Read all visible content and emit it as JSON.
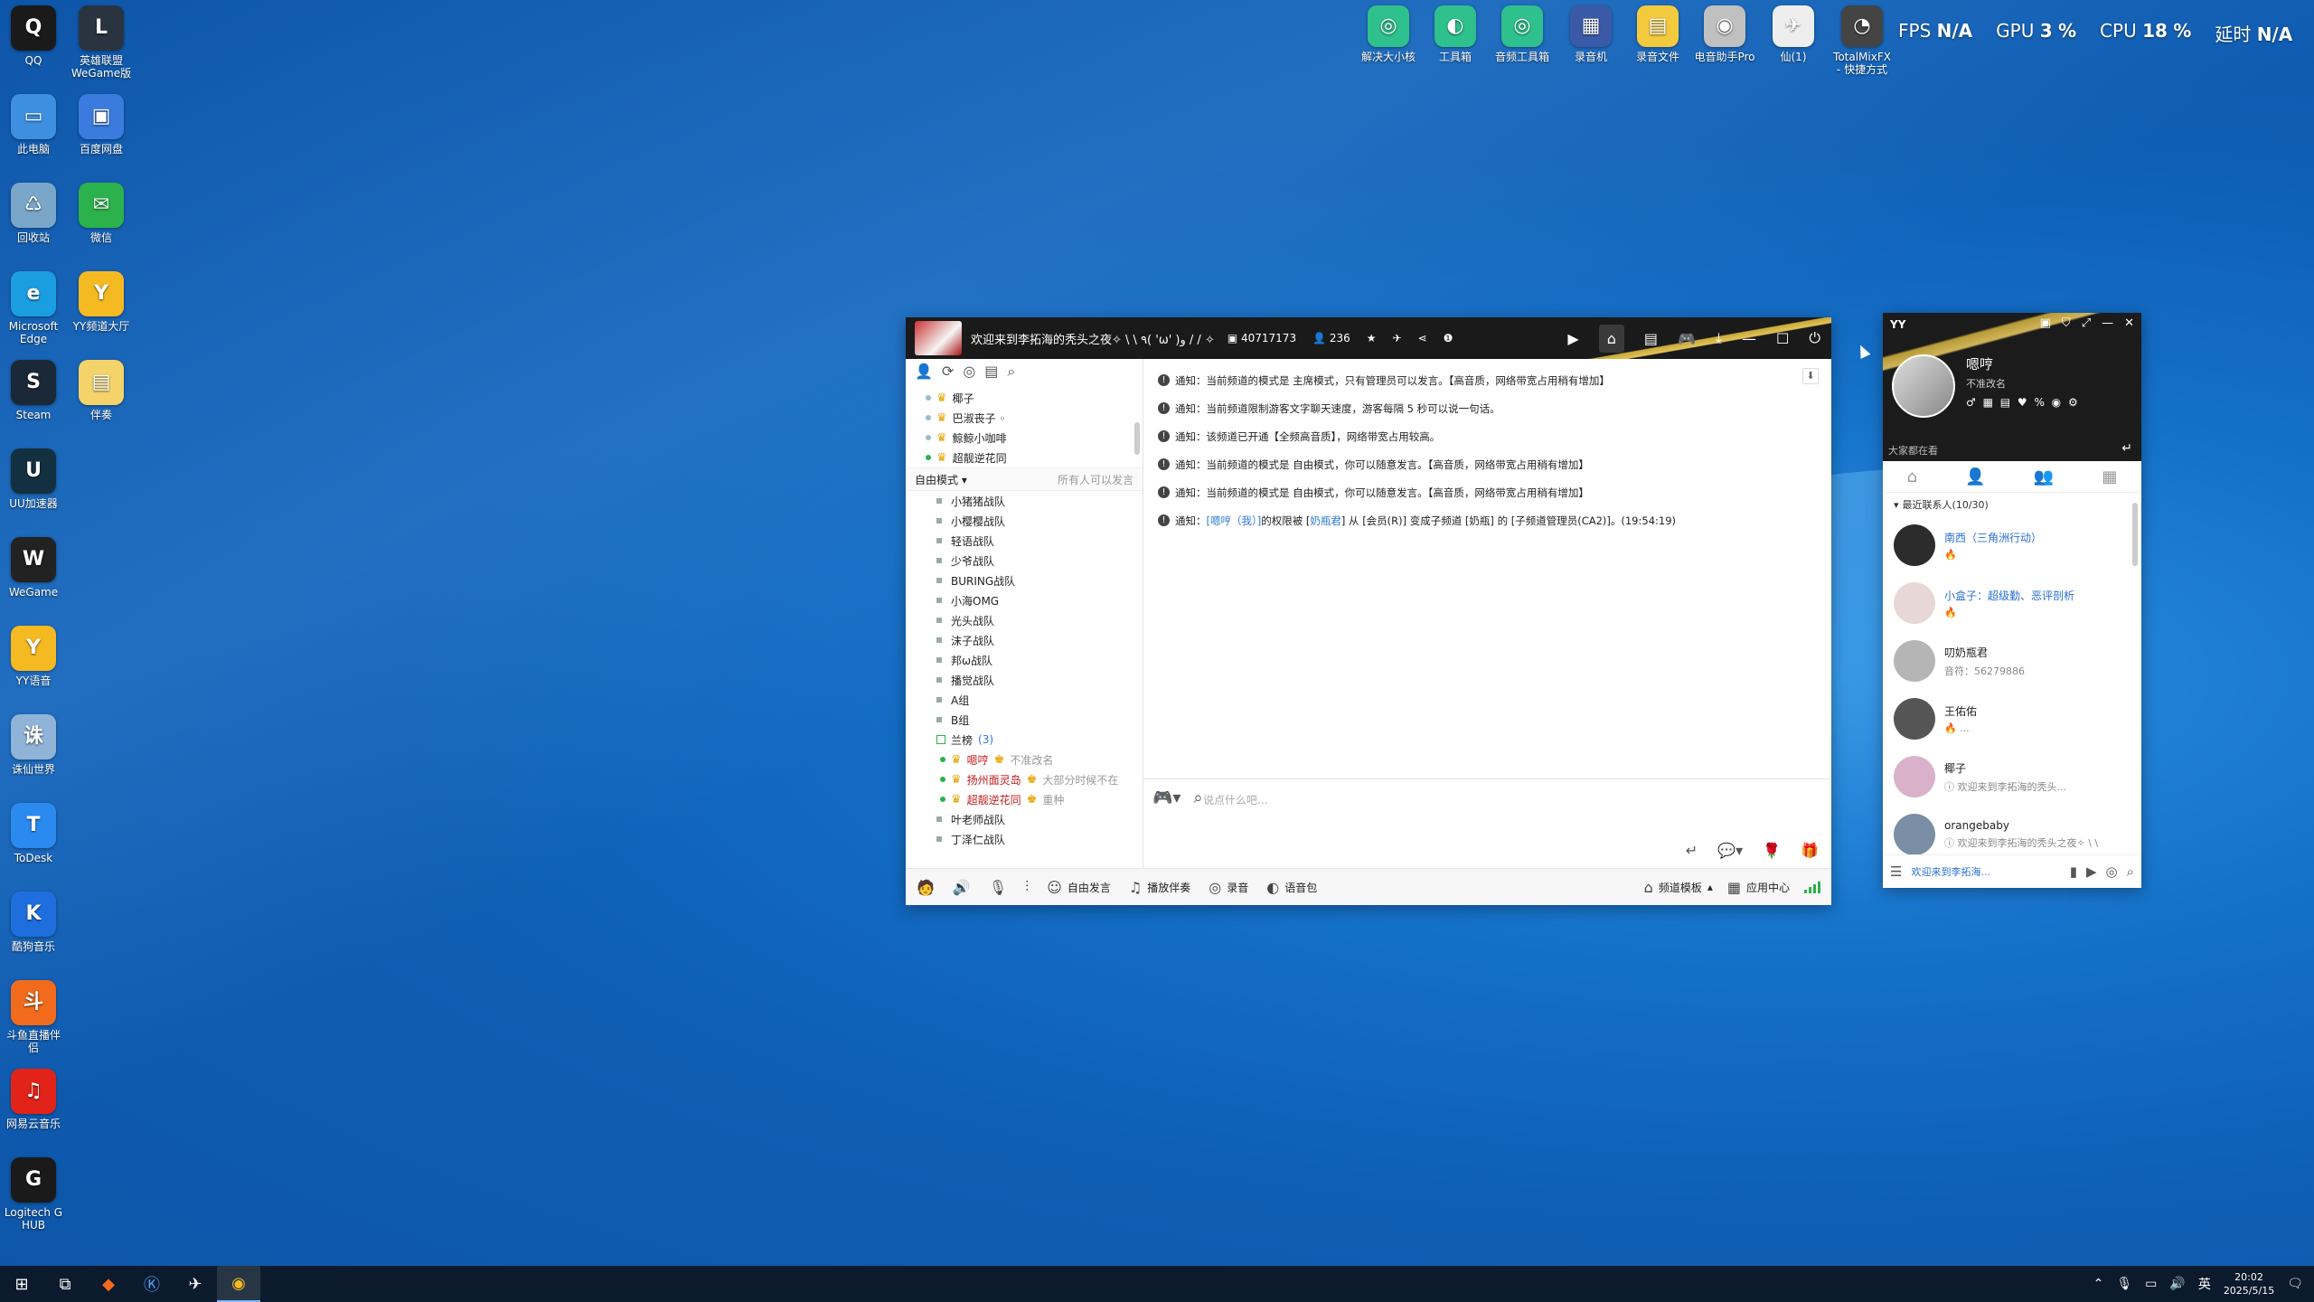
{
  "desktop": {
    "left_icons": [
      {
        "label": "QQ",
        "icon": "qq-icon",
        "color": "#1a1a1a",
        "glyph": "Q"
      },
      {
        "label": "英雄联盟WeGame版",
        "icon": "lol-icon",
        "color": "#2a3440",
        "glyph": "L"
      },
      {
        "label": "此电脑",
        "icon": "computer-icon",
        "color": "#3d8fe0",
        "glyph": "▭"
      },
      {
        "label": "百度网盘",
        "icon": "baidu-pan-icon",
        "color": "#3b7be0",
        "glyph": "▣"
      },
      {
        "label": "回收站",
        "icon": "recycle-bin-icon",
        "color": "#7aa6c9",
        "glyph": "♺"
      },
      {
        "label": "微信",
        "icon": "wechat-icon",
        "color": "#2bb24c",
        "glyph": "✉"
      },
      {
        "label": "Microsoft Edge",
        "icon": "edge-icon",
        "color": "#1b9de2",
        "glyph": "e"
      },
      {
        "label": "YY频道大厅",
        "icon": "yy-hall-icon",
        "color": "#f5b921",
        "glyph": "Y"
      },
      {
        "label": "Steam",
        "icon": "steam-icon",
        "color": "#1b2838",
        "glyph": "S"
      },
      {
        "label": "伴奏",
        "icon": "folder-icon",
        "color": "#f3d36a",
        "glyph": "▤"
      },
      {
        "label": "UU加速器",
        "icon": "uu-icon",
        "color": "#133040",
        "glyph": "U"
      },
      {
        "label": "WeGame",
        "icon": "wegame-icon",
        "color": "#222",
        "glyph": "W"
      },
      {
        "label": "YY语音",
        "icon": "yy-voice-icon",
        "color": "#f5b921",
        "glyph": "Y"
      },
      {
        "label": "诛仙世界",
        "icon": "zhuxian-icon",
        "color": "#8fb4d8",
        "glyph": "诛"
      },
      {
        "label": "ToDesk",
        "icon": "todesk-icon",
        "color": "#2a8af0",
        "glyph": "T"
      },
      {
        "label": "酷狗音乐",
        "icon": "kugou-icon",
        "color": "#1e6fdd",
        "glyph": "K"
      },
      {
        "label": "斗鱼直播伴侣",
        "icon": "douyu-icon",
        "color": "#f26b1d",
        "glyph": "斗"
      },
      {
        "label": "网易云音乐",
        "icon": "netease-music-icon",
        "color": "#e2231a",
        "glyph": "♫"
      },
      {
        "label": "Logitech G HUB",
        "icon": "logitech-icon",
        "color": "#1a1a1a",
        "glyph": "G"
      }
    ],
    "top_icons": [
      {
        "label": "解决大小核",
        "icon": "cpu-core-icon",
        "color": "#2fc18d",
        "glyph": "◎"
      },
      {
        "label": "工具箱",
        "icon": "toolbox-icon",
        "color": "#2fc18d",
        "glyph": "◐"
      },
      {
        "label": "音频工具箱",
        "icon": "audio-toolbox-icon",
        "color": "#2fc18d",
        "glyph": "◎"
      },
      {
        "label": "录音机",
        "icon": "recorder-icon",
        "color": "#3a5aa8",
        "glyph": "▦"
      },
      {
        "label": "录音文件",
        "icon": "folder-icon",
        "color": "#f3c93e",
        "glyph": "▤"
      },
      {
        "label": "电音助手Pro",
        "icon": "autotune-icon",
        "color": "#c0c0c0",
        "glyph": "◉"
      },
      {
        "label": "仙(1)",
        "icon": "xian-icon",
        "color": "#eeeeee",
        "glyph": "✈"
      },
      {
        "label": "TotalMixFX - 快捷方式",
        "icon": "totalmix-icon",
        "color": "#444",
        "glyph": "◔"
      }
    ],
    "perf": {
      "fps_label": "FPS",
      "fps": "N/A",
      "gpu_label": "GPU",
      "gpu": "3",
      "cpu_label": "CPU",
      "cpu": "18",
      "lat_label": "延时",
      "lat": "N/A",
      "pct": "%"
    }
  },
  "yy": {
    "title": "欢迎来到李拓海的秃头之夜✧ \\ \\ ٩( 'ω' )و / / ✧",
    "channel_id": "40717173",
    "online": "236",
    "top_members": [
      {
        "name": "椰子",
        "online": false
      },
      {
        "name": "巴淑丧子 ◦",
        "online": false
      },
      {
        "name": "鲸鲸小咖啡",
        "online": false
      },
      {
        "name": "超靓逆花同",
        "online": true
      }
    ],
    "mode_label": "自由模式",
    "mode_right": "所有人可以发言",
    "subchannels": [
      "小猪猪战队",
      "小樱樱战队",
      "轻语战队",
      "少爷战队",
      "BURING战队",
      "小海OMG",
      "光头战队",
      "沫子战队",
      "邦ω战队",
      "播觉战队",
      "A组",
      "B组"
    ],
    "group_name": "兰榜",
    "group_count": "(3)",
    "group_members": [
      {
        "name": "嗯哼",
        "status": "不准改名"
      },
      {
        "name": "扬州面灵岛",
        "status": "大部分时候不在"
      },
      {
        "name": "超靓逆花同",
        "status": "重种"
      }
    ],
    "more_channels": [
      "叶老师战队",
      "丁泽仁战队"
    ],
    "notice_prefix": "通知：",
    "notices": [
      "当前频道的模式是 主席模式，只有管理员可以发言。【高音质，网络带宽占用稍有增加】",
      "当前频道限制游客文字聊天速度，游客每隔 5 秒可以说一句话。",
      "该频道已开通【全频高音质】，网络带宽占用较高。",
      "当前频道的模式是 自由模式，你可以随意发言。【高音质，网络带宽占用稍有增加】",
      "当前频道的模式是 自由模式，你可以随意发言。【高音质，网络带宽占用稍有增加】"
    ],
    "perm_notice": {
      "who": "[嗯哼（我）]",
      "mid": " 的权限被 [",
      "by": "奶瓶君",
      "tail": "] 从 [会员(R)] 变成子频道 [奶瓶] 的 [子频道管理员(CA2)]。(19:54:19)"
    },
    "input_placeholder": "说点什么吧...",
    "bottom": {
      "free_speak": "自由发言",
      "accompany": "播放伴奏",
      "record": "录音",
      "voice_pack": "语音包",
      "template": "频道模板",
      "app_center": "应用中心"
    }
  },
  "side": {
    "brand": "YY",
    "user_name": "嗯哼",
    "signature": "不准改名",
    "watching": "大家都在看",
    "recent_label": "最近联系人(10/30)",
    "contacts": [
      {
        "name": "南西（三角洲行动）",
        "sub": "🔥",
        "blue": true,
        "avatar": "#2c2c2c"
      },
      {
        "name": "小盒子：超级勤、恶评剖析",
        "sub": "🔥",
        "blue": true,
        "avatar": "#e8d7d7"
      },
      {
        "name": "叨奶瓶君",
        "sub": "音符：56279886",
        "blue": false,
        "avatar": "#b5b5b5"
      },
      {
        "name": "王佑佑",
        "sub": "🔥 ...",
        "blue": false,
        "avatar": "#555"
      },
      {
        "name": "椰子",
        "sub": "ⓘ 欢迎来到李拓海的秃头...",
        "blue": false,
        "avatar": "#d9b2c9"
      },
      {
        "name": "orangebaby",
        "sub": "ⓘ 欢迎来到李拓海的秃头之夜✧ \\ \\",
        "blue": false,
        "avatar": "#7a8fa5"
      }
    ],
    "bottom_text": "欢迎来到李拓海..."
  },
  "taskbar": {
    "time": "20:02",
    "date": "2025/5/15",
    "ime": "英"
  }
}
